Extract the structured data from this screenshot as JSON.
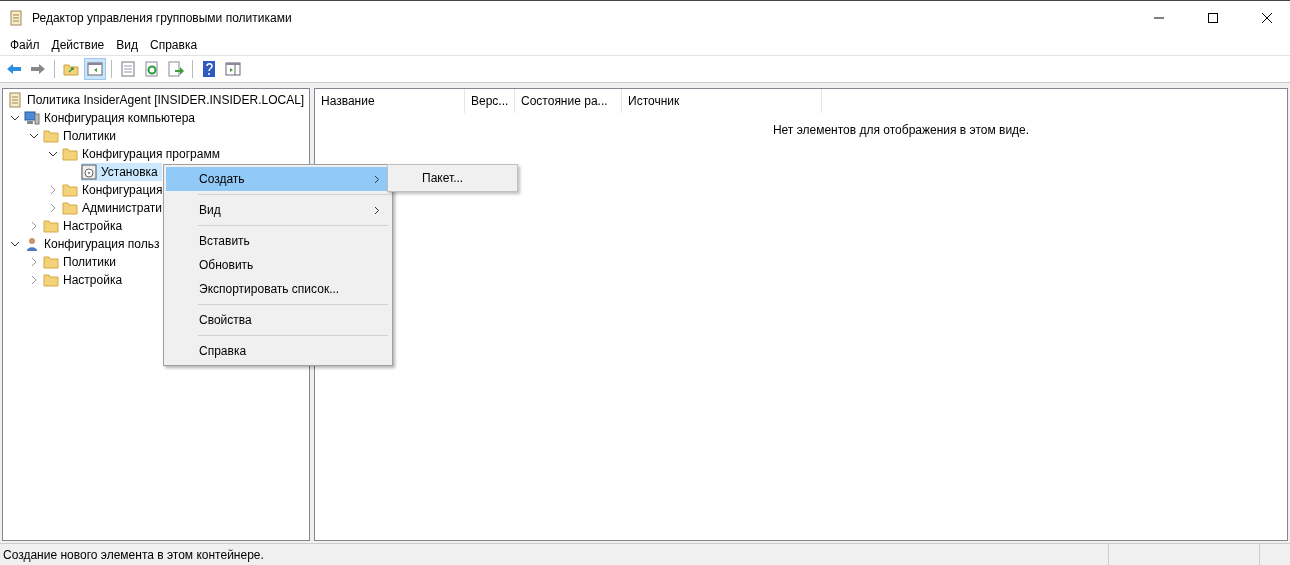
{
  "window": {
    "title": "Редактор управления групповыми политиками"
  },
  "menu_bar": [
    "Файл",
    "Действие",
    "Вид",
    "Справка"
  ],
  "toolbar": [
    {
      "kind": "back",
      "pressed": false
    },
    {
      "kind": "forward",
      "pressed": false
    },
    {
      "kind": "separator"
    },
    {
      "kind": "up",
      "pressed": false
    },
    {
      "kind": "tree",
      "pressed": true
    },
    {
      "kind": "separator"
    },
    {
      "kind": "properties",
      "pressed": false
    },
    {
      "kind": "refresh",
      "pressed": false
    },
    {
      "kind": "export",
      "pressed": false
    },
    {
      "kind": "separator"
    },
    {
      "kind": "help",
      "pressed": false
    },
    {
      "kind": "actions",
      "pressed": false
    }
  ],
  "tree": {
    "label": "Политика InsiderAgent [INSIDER.INSIDER.LOCAL]",
    "kind": "policy",
    "children": [
      {
        "label": "Конфигурация компьютера",
        "kind": "computer",
        "expanded": true,
        "selected": false,
        "children": [
          {
            "label": "Политики",
            "kind": "folder",
            "expanded": true,
            "selected": false,
            "children": [
              {
                "label": "Конфигурация программ",
                "kind": "folder",
                "expanded": true,
                "selected": false,
                "children": [
                  {
                    "label": "Установка",
                    "kind": "installer",
                    "selected": true
                  }
                ]
              },
              {
                "label": "Конфигурация",
                "kind": "folder",
                "expanded": false,
                "selected": false
              },
              {
                "label": "Администрати",
                "kind": "folder",
                "expanded": false,
                "selected": false
              }
            ]
          },
          {
            "label": "Настройка",
            "kind": "folder",
            "expanded": false,
            "selected": false
          }
        ]
      },
      {
        "label": "Конфигурация польз",
        "kind": "user",
        "expanded": true,
        "selected": false,
        "children": [
          {
            "label": "Политики",
            "kind": "folder",
            "expanded": false,
            "selected": false
          },
          {
            "label": "Настройка",
            "kind": "folder",
            "expanded": false,
            "selected": false
          }
        ]
      }
    ]
  },
  "table": {
    "columns": [
      "Название",
      "Верс...",
      "Состояние ра...",
      "Источник"
    ],
    "empty_message": "Нет элементов для отображения в этом виде."
  },
  "context_menu": {
    "items": [
      {
        "kind": "item",
        "label": "Создать",
        "submenu": true,
        "selected": true
      },
      {
        "kind": "separator"
      },
      {
        "kind": "item",
        "label": "Вид",
        "submenu": true,
        "selected": false
      },
      {
        "kind": "separator"
      },
      {
        "kind": "item",
        "label": "Вставить",
        "submenu": false,
        "selected": false
      },
      {
        "kind": "item",
        "label": "Обновить",
        "submenu": false,
        "selected": false
      },
      {
        "kind": "item",
        "label": "Экспортировать список...",
        "submenu": false,
        "selected": false
      },
      {
        "kind": "separator"
      },
      {
        "kind": "item",
        "label": "Свойства",
        "submenu": false,
        "selected": false
      },
      {
        "kind": "separator"
      },
      {
        "kind": "item",
        "label": "Справка",
        "submenu": false,
        "selected": false
      }
    ],
    "submenu": [
      {
        "label": "Пакет..."
      }
    ]
  },
  "status_bar": {
    "text": "Создание нового элемента в этом контейнере."
  }
}
